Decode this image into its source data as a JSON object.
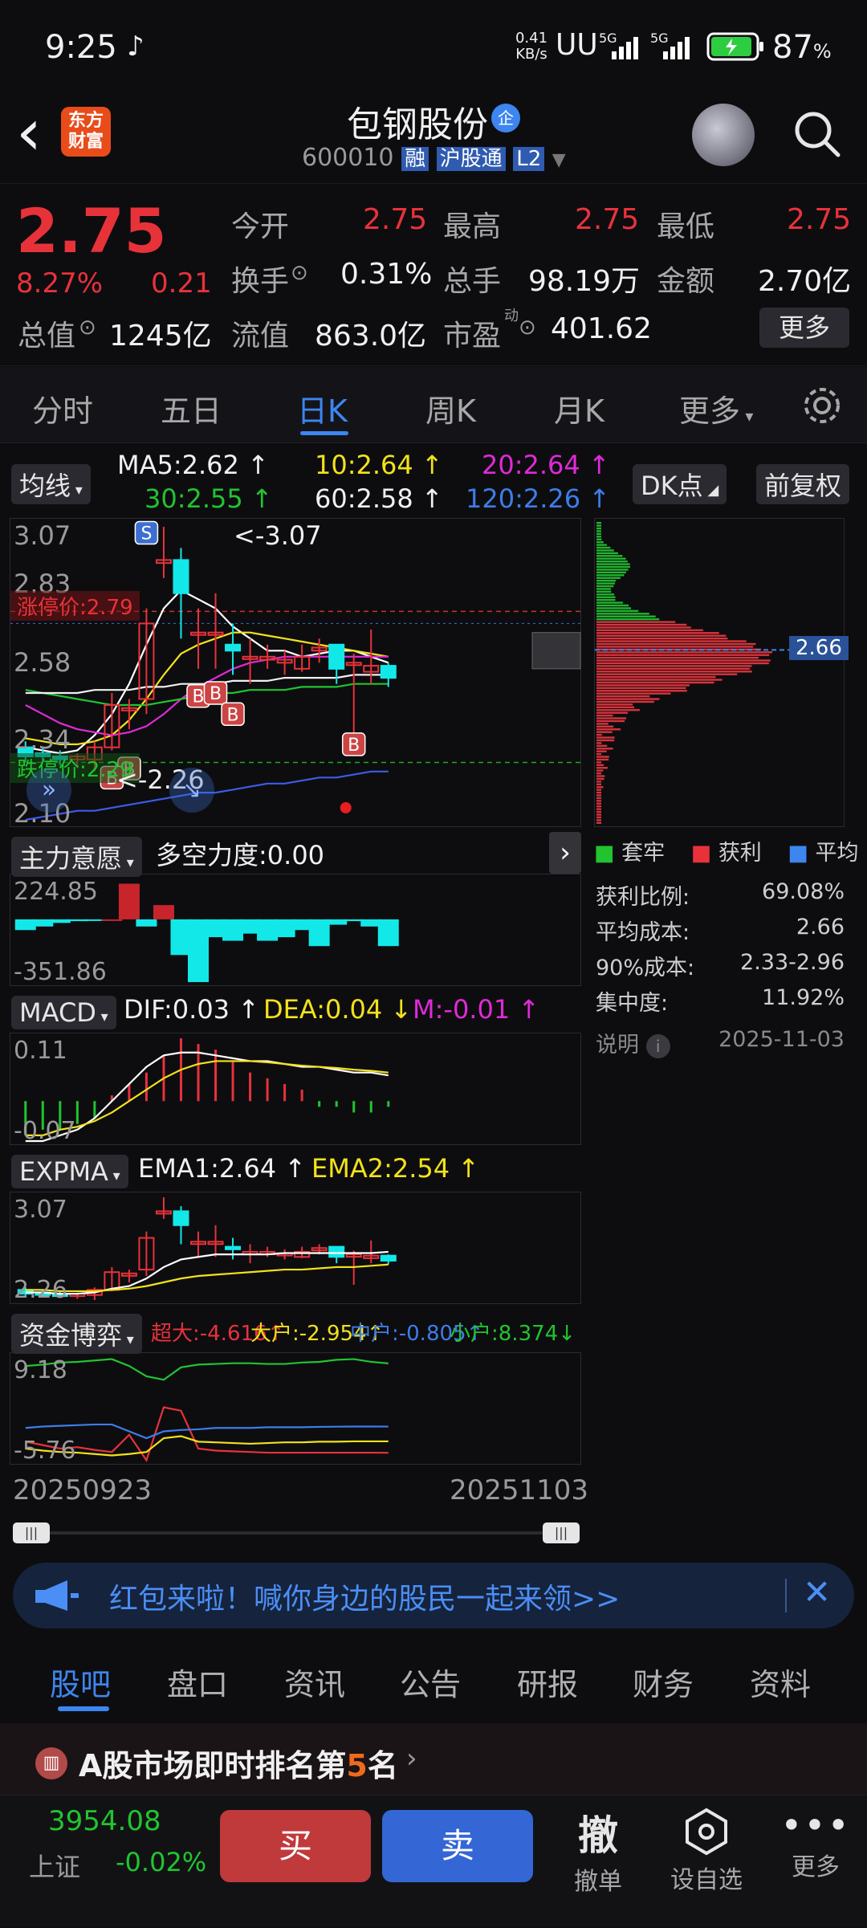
{
  "status": {
    "time": "9:25",
    "net_speed": "0.41",
    "net_unit": "KB/s",
    "sig1": "5G",
    "sig2": "5G",
    "battery": "87",
    "battery_unit": "%"
  },
  "header": {
    "back": "‹",
    "logo_line1": "东方",
    "logo_line2": "财富",
    "stock_name": "包钢股份",
    "badge": "企",
    "code": "600010",
    "tag_margin": "融",
    "tag_connect": "沪股通",
    "tag_l2": "L2"
  },
  "quote": {
    "price": "2.75",
    "change_pct": "8.27%",
    "change_amt": "0.21",
    "open_label": "今开",
    "open": "2.75",
    "high_label": "最高",
    "high": "2.75",
    "low_label": "最低",
    "low": "2.75",
    "turnover_label": "换手",
    "turnover": "0.31%",
    "volume_label": "总手",
    "volume": "98.19万",
    "amount_label": "金额",
    "amount": "2.70亿",
    "mcap_label": "总值",
    "mcap": "1245亿",
    "float_label": "流值",
    "float": "863.0亿",
    "pe_label": "市盈",
    "pe_sup": "动",
    "pe": "401.62",
    "more": "更多"
  },
  "periods": {
    "tabs": [
      "分时",
      "五日",
      "日K",
      "周K",
      "月K",
      "更多"
    ],
    "active": 2
  },
  "kline": {
    "ma_chip": "均线",
    "ma5": "MA5:2.62",
    "ma10": "10:2.64",
    "ma20": "20:2.64",
    "ma30": "30:2.55",
    "ma60": "60:2.58",
    "ma120": "120:2.26",
    "dk": "DK点",
    "adjust": "前复权",
    "y_top": "3.07",
    "y_2": "2.83",
    "y_3": "2.58",
    "y_4": "2.34",
    "y_bot": "2.10",
    "limit_up": "涨停价:2.79",
    "limit_down": "跌停价:2.29",
    "max_ann": "<-3.07",
    "min_ann": "<-2.26",
    "s_mark": "S",
    "b_mark": "B",
    "cost_tag": "2.66"
  },
  "legend": {
    "trapped": "套牢",
    "profit": "获利",
    "avg": "平均"
  },
  "chip_stats": {
    "profit_ratio_label": "获利比例:",
    "profit_ratio": "69.08%",
    "avg_cost_label": "平均成本:",
    "avg_cost": "2.66",
    "cost90_label": "90%成本:",
    "cost90": "2.33-2.96",
    "concentration_label": "集中度:",
    "concentration": "11.92%",
    "explain": "说明",
    "date": "2025-11-03"
  },
  "ind1": {
    "name": "主力意愿",
    "force": "多空力度:0.00",
    "y_top": "224.85",
    "y_bot": "-351.86"
  },
  "macd": {
    "name": "MACD",
    "dif": "DIF:0.03",
    "dea": "DEA:0.04",
    "m": "M:-0.01",
    "y_top": "0.11",
    "y_bot": "-0.07"
  },
  "expma": {
    "name": "EXPMA",
    "ema1": "EMA1:2.64",
    "ema2": "EMA2:2.54",
    "y_top": "3.07",
    "y_bot": "2.26"
  },
  "fund": {
    "name": "资金博弈",
    "super": "超大:-4.616",
    "large": "大户:-2.954",
    "mid": "中户:-0.805",
    "small": "小户:8.374",
    "y_top": "9.18",
    "y_bot": "-5.76"
  },
  "dates": {
    "start": "20250923",
    "end": "20251103"
  },
  "banner": {
    "text": "红包来啦！喊你身边的股民一起来领>>"
  },
  "subtabs": {
    "tabs": [
      "股吧",
      "盘口",
      "资讯",
      "公告",
      "研报",
      "财务",
      "资料"
    ],
    "active": 0
  },
  "rank": {
    "prefix": "A股市场即时排名第",
    "num": "5",
    "suffix": "名"
  },
  "bottom": {
    "index_val": "3954.08",
    "index_name": "上证",
    "index_chg": "-0.02%",
    "buy": "买",
    "sell": "卖",
    "cancel": "撤",
    "cancel_label": "撤单",
    "watch_label": "设自选",
    "more_label": "更多"
  },
  "chart_data": [
    {
      "type": "line",
      "title": "日K",
      "series": [
        {
          "name": "MA5",
          "values": [
            2.34,
            2.33,
            2.32,
            2.33,
            2.38,
            2.45,
            2.55,
            2.68,
            2.8,
            2.86,
            2.83,
            2.8,
            2.74,
            2.7,
            2.66,
            2.66,
            2.64,
            2.65,
            2.66,
            2.66,
            2.64,
            2.62
          ]
        },
        {
          "name": "10",
          "values": [
            2.37,
            2.36,
            2.35,
            2.35,
            2.36,
            2.38,
            2.43,
            2.5,
            2.58,
            2.65,
            2.68,
            2.7,
            2.72,
            2.72,
            2.71,
            2.7,
            2.69,
            2.68,
            2.67,
            2.66,
            2.65,
            2.64
          ]
        },
        {
          "name": "20",
          "values": [
            2.48,
            2.45,
            2.42,
            2.4,
            2.39,
            2.38,
            2.39,
            2.41,
            2.45,
            2.5,
            2.54,
            2.57,
            2.6,
            2.62,
            2.63,
            2.64,
            2.64,
            2.64,
            2.64,
            2.64,
            2.64,
            2.64
          ]
        },
        {
          "name": "30",
          "values": [
            2.53,
            2.52,
            2.51,
            2.5,
            2.49,
            2.48,
            2.48,
            2.48,
            2.49,
            2.5,
            2.51,
            2.52,
            2.52,
            2.53,
            2.53,
            2.53,
            2.54,
            2.54,
            2.54,
            2.55,
            2.55,
            2.55
          ]
        },
        {
          "name": "60",
          "values": [
            2.52,
            2.52,
            2.52,
            2.52,
            2.53,
            2.53,
            2.53,
            2.54,
            2.54,
            2.55,
            2.55,
            2.55,
            2.56,
            2.56,
            2.56,
            2.57,
            2.57,
            2.57,
            2.57,
            2.58,
            2.58,
            2.58
          ]
        },
        {
          "name": "120",
          "values": [
            2.1,
            2.11,
            2.12,
            2.13,
            2.13,
            2.14,
            2.15,
            2.16,
            2.17,
            2.18,
            2.19,
            2.19,
            2.2,
            2.21,
            2.22,
            2.22,
            2.23,
            2.24,
            2.24,
            2.25,
            2.26,
            2.26
          ]
        }
      ],
      "candles": [
        [
          2.34,
          2.31,
          2.36,
          2.29
        ],
        [
          2.32,
          2.31,
          2.34,
          2.29
        ],
        [
          2.31,
          2.3,
          2.33,
          2.28
        ],
        [
          2.3,
          2.31,
          2.32,
          2.27
        ],
        [
          2.3,
          2.34,
          2.36,
          2.26
        ],
        [
          2.34,
          2.48,
          2.52,
          2.33
        ],
        [
          2.47,
          2.47,
          2.5,
          2.4
        ],
        [
          2.5,
          2.75,
          2.8,
          2.45
        ],
        [
          2.95,
          2.96,
          3.07,
          2.9
        ],
        [
          2.96,
          2.85,
          3.0,
          2.7
        ],
        [
          2.72,
          2.72,
          2.8,
          2.6
        ],
        [
          2.72,
          2.72,
          2.85,
          2.6
        ],
        [
          2.68,
          2.66,
          2.75,
          2.58
        ],
        [
          2.64,
          2.64,
          2.7,
          2.55
        ],
        [
          2.63,
          2.64,
          2.68,
          2.6
        ],
        [
          2.62,
          2.63,
          2.66,
          2.58
        ],
        [
          2.6,
          2.64,
          2.68,
          2.59
        ],
        [
          2.66,
          2.67,
          2.7,
          2.62
        ],
        [
          2.68,
          2.6,
          2.68,
          2.55
        ],
        [
          2.62,
          2.62,
          2.65,
          2.38
        ],
        [
          2.59,
          2.61,
          2.73,
          2.55
        ],
        [
          2.61,
          2.57,
          2.62,
          2.54
        ]
      ],
      "ylim": [
        2.1,
        3.07
      ]
    },
    {
      "type": "bar",
      "title": "主力意愿",
      "values": [
        -60,
        -40,
        -20,
        -10,
        -5,
        0,
        200,
        -40,
        80,
        -200,
        -351.86,
        -100,
        -120,
        -80,
        -120,
        -100,
        -60,
        -150,
        -30,
        -10,
        -40,
        -150
      ],
      "ylim": [
        -351.86,
        224.85
      ]
    },
    {
      "type": "bar",
      "title": "MACD",
      "values": [
        -0.06,
        -0.05,
        -0.05,
        -0.04,
        -0.03,
        0.01,
        0.03,
        0.05,
        0.08,
        0.11,
        0.1,
        0.09,
        0.07,
        0.05,
        0.04,
        0.03,
        0.02,
        -0.01,
        -0.01,
        -0.02,
        -0.02,
        -0.01
      ],
      "ylim": [
        -0.07,
        0.11
      ]
    },
    {
      "type": "line",
      "title": "资金博弈",
      "series": [
        {
          "name": "超大",
          "values": [
            -3,
            -3.5,
            -4,
            -3.8,
            -4.2,
            -4.5,
            -2,
            -5.7,
            2,
            1.5,
            -4,
            -4.3,
            -4.4,
            -4.5,
            -4.6,
            -4.6,
            -4.6,
            -4.6,
            -4.6,
            -4.6,
            -4.6,
            -4.616
          ]
        },
        {
          "name": "大户",
          "values": [
            -4,
            -4.3,
            -4.5,
            -4.6,
            -4.8,
            -5,
            -4.8,
            -4.5,
            -2.5,
            -2.2,
            -3,
            -3.1,
            -3.2,
            -3.3,
            -3.2,
            -3.1,
            -3.1,
            -3.0,
            -3.0,
            -2.95,
            -2.95,
            -2.954
          ]
        },
        {
          "name": "中户",
          "values": [
            -1,
            -0.8,
            -0.7,
            -0.6,
            -0.5,
            -0.5,
            -1.5,
            -2.5,
            -1.5,
            -1.3,
            -1.2,
            -1.0,
            -1.0,
            -1.0,
            -0.9,
            -0.9,
            -0.9,
            -0.85,
            -0.82,
            -0.8,
            -0.8,
            -0.805
          ]
        },
        {
          "name": "小户",
          "values": [
            8,
            8.2,
            8.5,
            8.6,
            8.8,
            9.0,
            8.0,
            6.5,
            6,
            7.8,
            8.2,
            8.3,
            8.4,
            8.4,
            8.3,
            8.3,
            8.5,
            8.6,
            8.9,
            9.0,
            8.6,
            8.374
          ]
        }
      ],
      "ylim": [
        -5.76,
        9.18
      ]
    }
  ]
}
